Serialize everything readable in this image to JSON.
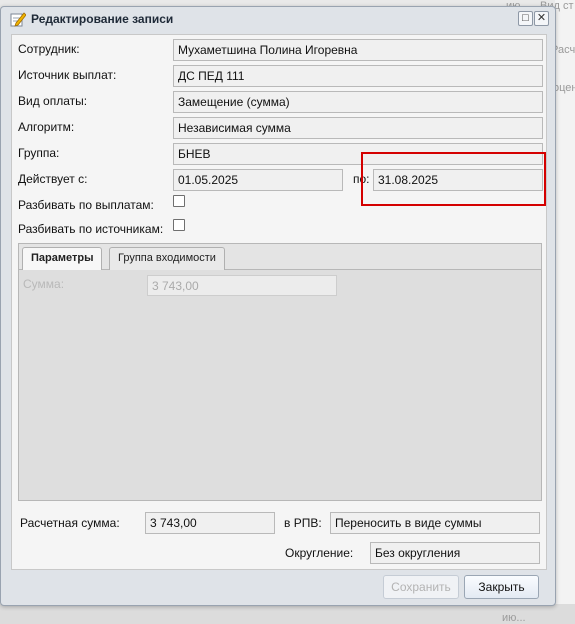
{
  "background": {
    "right_fragments": [
      "ию...",
      "Вид ст",
      "Расчет",
      "оцен"
    ],
    "bottom_fragment": "ию..."
  },
  "window": {
    "title": "Редактирование записи",
    "title_icon": "edit-record-icon",
    "btn_maximize": "□",
    "btn_close": "✕"
  },
  "form": {
    "employee_label": "Сотрудник:",
    "employee_value": "Мухаметшина Полина Игоревна",
    "source_label": "Источник выплат:",
    "source_value": "ДС ПЕД 111",
    "paytype_label": "Вид оплаты:",
    "paytype_value": "Замещение (сумма)",
    "algorithm_label": "Алгоритм:",
    "algorithm_value": "Независимая сумма",
    "group_label": "Группа:",
    "group_value": "БНЕВ",
    "valid_from_label": "Действует с:",
    "valid_from_value": "01.05.2025",
    "valid_to_label": "по:",
    "valid_to_value": "31.08.2025",
    "split_payments_label": "Разбивать по выплатам:",
    "split_sources_label": "Разбивать по источникам:"
  },
  "tabs": [
    {
      "label": "Параметры",
      "active": true
    },
    {
      "label": "Группа входимости",
      "active": false
    }
  ],
  "params": {
    "sum_label": "Сумма:",
    "sum_value": "3 743,00"
  },
  "footer": {
    "calc_sum_label": "Расчетная сумма:",
    "calc_sum_value": "3 743,00",
    "rpv_label": "в РПВ:",
    "rpv_value": "Переносить в виде суммы",
    "rounding_label": "Округление:",
    "rounding_value": "Без округления"
  },
  "buttons": {
    "save": "Сохранить",
    "close": "Закрыть"
  },
  "colors": {
    "highlight": "#d40000"
  }
}
